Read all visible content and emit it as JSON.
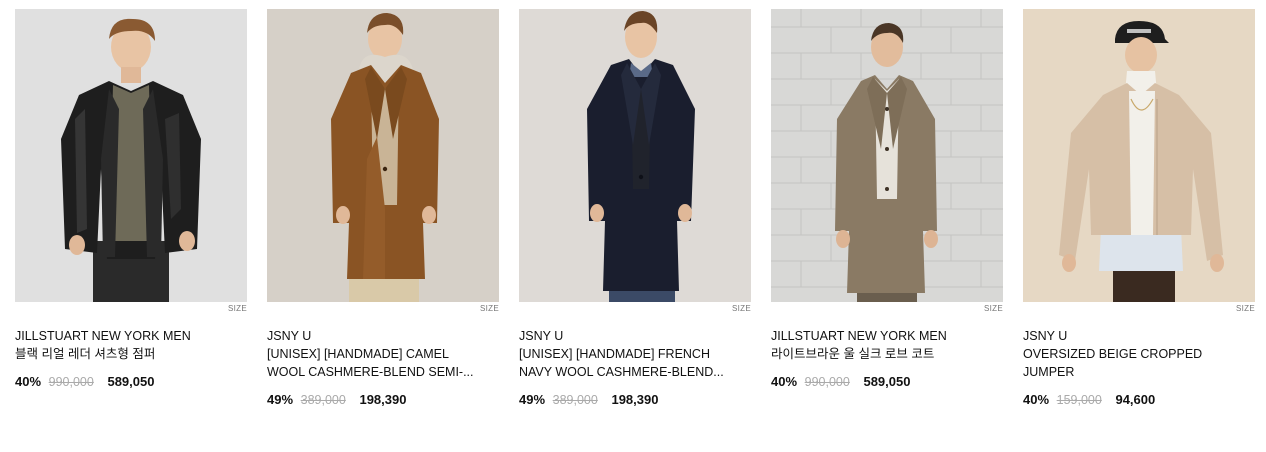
{
  "products": [
    {
      "brand": "JILLSTUART NEW YORK MEN",
      "name": "블랙 리얼 레더 셔츠형 점퍼",
      "discount": "40%",
      "original_price": "990,000",
      "sale_price": "589,050",
      "size_label": "SIZE",
      "image_colors": {
        "bg": "#dcdcdc",
        "garment": "#1e1e1e",
        "inner": "#6e6a58",
        "pants": "#2a2a2a"
      }
    },
    {
      "brand": "JSNY U",
      "name": "[UNISEX] [HANDMADE] CAMEL WOOL CASHMERE-BLEND SEMI-...",
      "discount": "49%",
      "original_price": "389,000",
      "sale_price": "198,390",
      "size_label": "SIZE",
      "image_colors": {
        "bg": "#d6d0c8",
        "garment": "#8a5424",
        "inner": "#c9b496",
        "pants": "#d9c9a8"
      }
    },
    {
      "brand": "JSNY U",
      "name": "[UNISEX] [HANDMADE] FRENCH NAVY WOOL CASHMERE-BLEND...",
      "discount": "49%",
      "original_price": "389,000",
      "sale_price": "198,390",
      "size_label": "SIZE",
      "image_colors": {
        "bg": "#dedad6",
        "garment": "#1a1e2e",
        "inner": "#20232c",
        "pants": "#3b4a66"
      }
    },
    {
      "brand": "JILLSTUART NEW YORK MEN",
      "name": "라이트브라운 울 실크 로브 코트",
      "discount": "40%",
      "original_price": "990,000",
      "sale_price": "589,050",
      "size_label": "SIZE",
      "image_colors": {
        "bg": "#d8d8d6",
        "garment": "#8a7a64",
        "inner": "#e6e2da",
        "pants": "#6a5e4e"
      }
    },
    {
      "brand": "JSNY U",
      "name": "OVERSIZED BEIGE CROPPED JUMPER",
      "discount": "40%",
      "original_price": "159,000",
      "sale_price": "94,600",
      "size_label": "SIZE",
      "image_colors": {
        "bg": "#e6d8c4",
        "garment": "#d6bfa6",
        "inner": "#f2f0ea",
        "pants": "#3a2a20"
      }
    }
  ]
}
